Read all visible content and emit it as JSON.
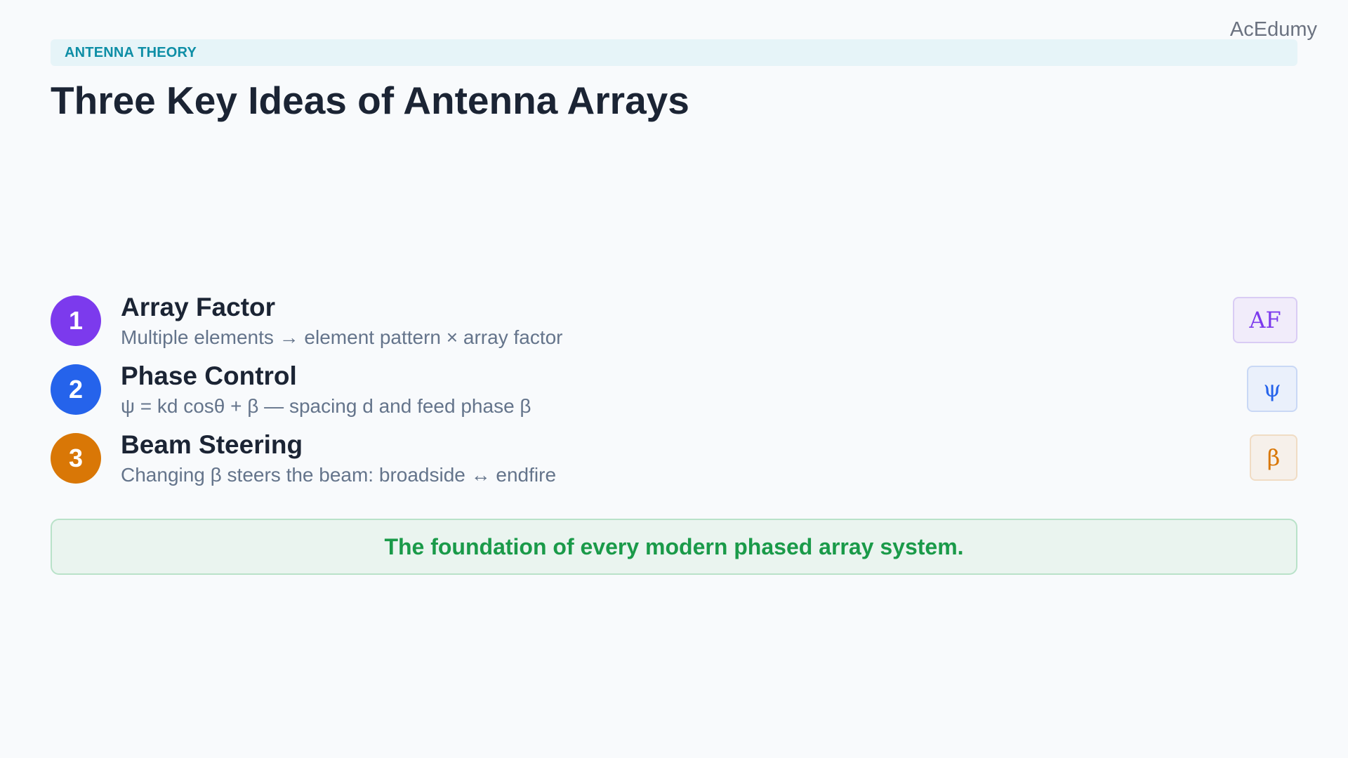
{
  "brand": "AcEdumy",
  "category": "ANTENNA THEORY",
  "title": "Three Key Ideas of Antenna Arrays",
  "ideas": [
    {
      "number": "1",
      "title": "Array Factor",
      "description": "Multiple elements → element pattern × array factor",
      "badge": "AF",
      "accent_color": "#7c3aed",
      "badge_bg": "#f1ecfa",
      "badge_border": "#d9ccf4"
    },
    {
      "number": "2",
      "title": "Phase Control",
      "description": "ψ = kd cosθ + β — spacing d and feed phase β",
      "badge": "ψ",
      "accent_color": "#2563eb",
      "badge_bg": "#eaf0fb",
      "badge_border": "#c9d8f5"
    },
    {
      "number": "3",
      "title": "Beam Steering",
      "description": "Changing β steers the beam: broadside ↔ endfire",
      "badge": "β",
      "accent_color": "#d97706",
      "badge_bg": "#f6f0ea",
      "badge_border": "#f0dcc4"
    }
  ],
  "conclusion": "The foundation of every modern phased array system."
}
